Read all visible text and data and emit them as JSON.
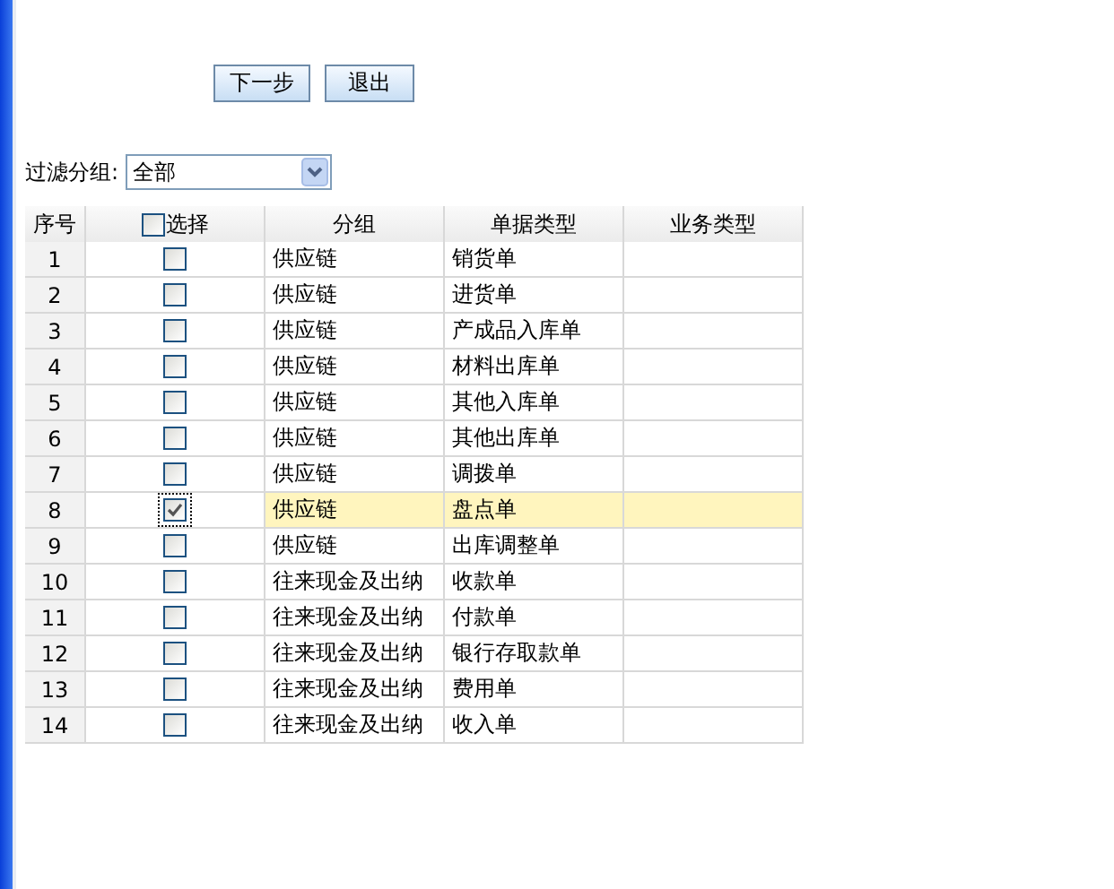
{
  "buttons": [
    {
      "label": "下一步"
    },
    {
      "label": "退出"
    }
  ],
  "filter": {
    "label": "过滤分组:",
    "value": "全部"
  },
  "table": {
    "columns": [
      "序号",
      "选择",
      "分组",
      "单据类型",
      "业务类型"
    ],
    "select_all_checked": false,
    "rows": [
      {
        "no": "1",
        "checked": false,
        "selected": false,
        "group": "供应链",
        "type": "销货单"
      },
      {
        "no": "2",
        "checked": false,
        "selected": false,
        "group": "供应链",
        "type": "进货单"
      },
      {
        "no": "3",
        "checked": false,
        "selected": false,
        "group": "供应链",
        "type": "产成品入库单"
      },
      {
        "no": "4",
        "checked": false,
        "selected": false,
        "group": "供应链",
        "type": "材料出库单"
      },
      {
        "no": "5",
        "checked": false,
        "selected": false,
        "group": "供应链",
        "type": "其他入库单"
      },
      {
        "no": "6",
        "checked": false,
        "selected": false,
        "group": "供应链",
        "type": "其他出库单"
      },
      {
        "no": "7",
        "checked": false,
        "selected": false,
        "group": "供应链",
        "type": "调拨单"
      },
      {
        "no": "8",
        "checked": true,
        "selected": true,
        "group": "供应链",
        "type": "盘点单"
      },
      {
        "no": "9",
        "checked": false,
        "selected": false,
        "group": "供应链",
        "type": "出库调整单"
      },
      {
        "no": "10",
        "checked": false,
        "selected": false,
        "group": "往来现金及出纳",
        "type": "收款单"
      },
      {
        "no": "11",
        "checked": false,
        "selected": false,
        "group": "往来现金及出纳",
        "type": "付款单"
      },
      {
        "no": "12",
        "checked": false,
        "selected": false,
        "group": "往来现金及出纳",
        "type": "银行存取款单"
      },
      {
        "no": "13",
        "checked": false,
        "selected": false,
        "group": "往来现金及出纳",
        "type": "费用单"
      },
      {
        "no": "14",
        "checked": false,
        "selected": false,
        "group": "往来现金及出纳",
        "type": "收入单"
      }
    ]
  }
}
